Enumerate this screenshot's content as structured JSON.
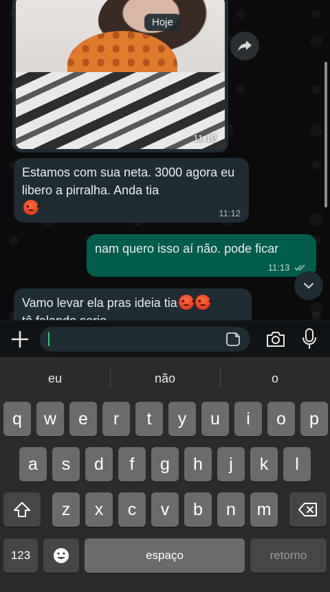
{
  "chat": {
    "day_chip": "Hoje",
    "media_message": {
      "time": "11:12"
    },
    "messages": [
      {
        "direction": "incoming",
        "text": "Estamos com sua neta. 3000 agora eu libero a pirralha. Anda tia",
        "time": "11:12"
      },
      {
        "direction": "outgoing",
        "text": "nam quero isso aí não. pode ficar",
        "time": "11:13"
      },
      {
        "direction": "incoming",
        "text": "Vamo levar ela pras ideia tia",
        "text_line2": "tô falando serio"
      }
    ]
  },
  "composer": {
    "input_value": ""
  },
  "keyboard": {
    "suggestions": [
      "eu",
      "não",
      "o"
    ],
    "row1": [
      "q",
      "w",
      "e",
      "r",
      "t",
      "y",
      "u",
      "i",
      "o",
      "p"
    ],
    "row2": [
      "a",
      "s",
      "d",
      "f",
      "g",
      "h",
      "j",
      "k",
      "l"
    ],
    "row3": [
      "z",
      "x",
      "c",
      "v",
      "b",
      "n",
      "m"
    ],
    "numbers_label": "123",
    "space_label": "espaço",
    "return_label": "retorno"
  },
  "colors": {
    "incoming_bubble": "#202c33",
    "outgoing_bubble": "#005c4b",
    "accent": "#25d366"
  }
}
